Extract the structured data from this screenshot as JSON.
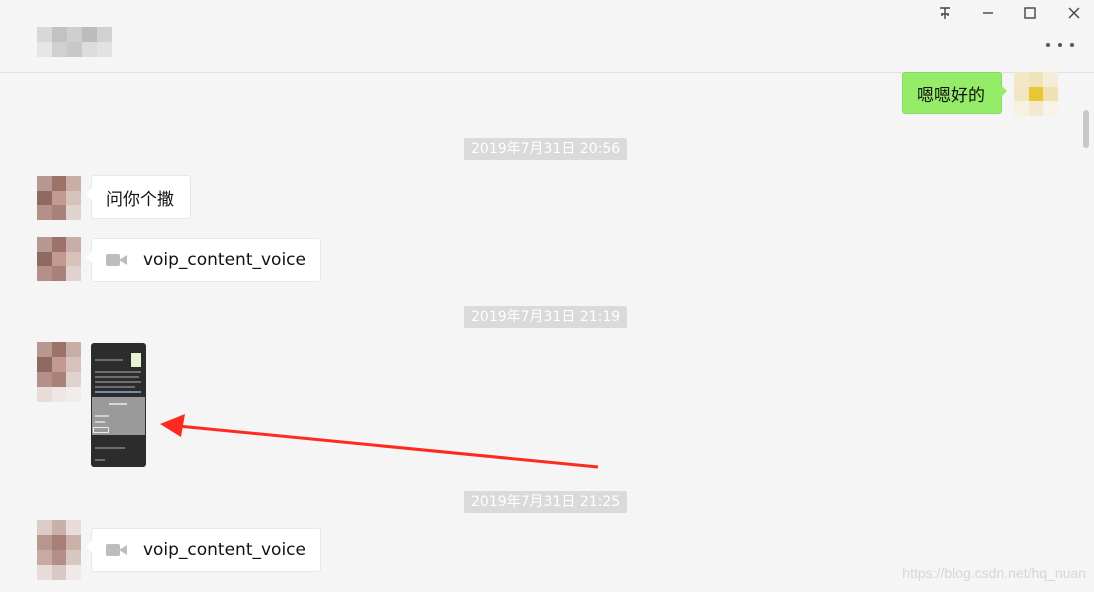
{
  "window": {
    "controls": {
      "pin_icon": "pin-icon",
      "minimize_icon": "minimize-icon",
      "maximize_icon": "maximize-icon",
      "close_icon": "close-icon"
    },
    "contact_name": "(pixelated)",
    "more_icon": "more-icon"
  },
  "messages": [
    {
      "type": "text",
      "direction": "outgoing",
      "text": "嗯嗯好的"
    },
    {
      "type": "timestamp",
      "text": "2019年7月31日 20:56"
    },
    {
      "type": "text",
      "direction": "incoming",
      "text": "问你个撒"
    },
    {
      "type": "call",
      "direction": "incoming",
      "text": "voip_content_voice",
      "icon": "video-call-icon"
    },
    {
      "type": "timestamp",
      "text": "2019年7月31日 21:19"
    },
    {
      "type": "image",
      "direction": "incoming",
      "icon": "image-thumbnail"
    },
    {
      "type": "timestamp",
      "text": "2019年7月31日 21:25"
    },
    {
      "type": "call",
      "direction": "incoming",
      "text": "voip_content_voice",
      "icon": "video-call-icon"
    }
  ],
  "annotation": {
    "arrow_color": "#ff2a1f"
  },
  "watermark": "https://blog.csdn.net/hq_nuan",
  "colors": {
    "background": "#f5f5f5",
    "outgoing_bubble": "#95ec69",
    "incoming_bubble": "#ffffff",
    "timestamp_bg": "#dadada"
  }
}
